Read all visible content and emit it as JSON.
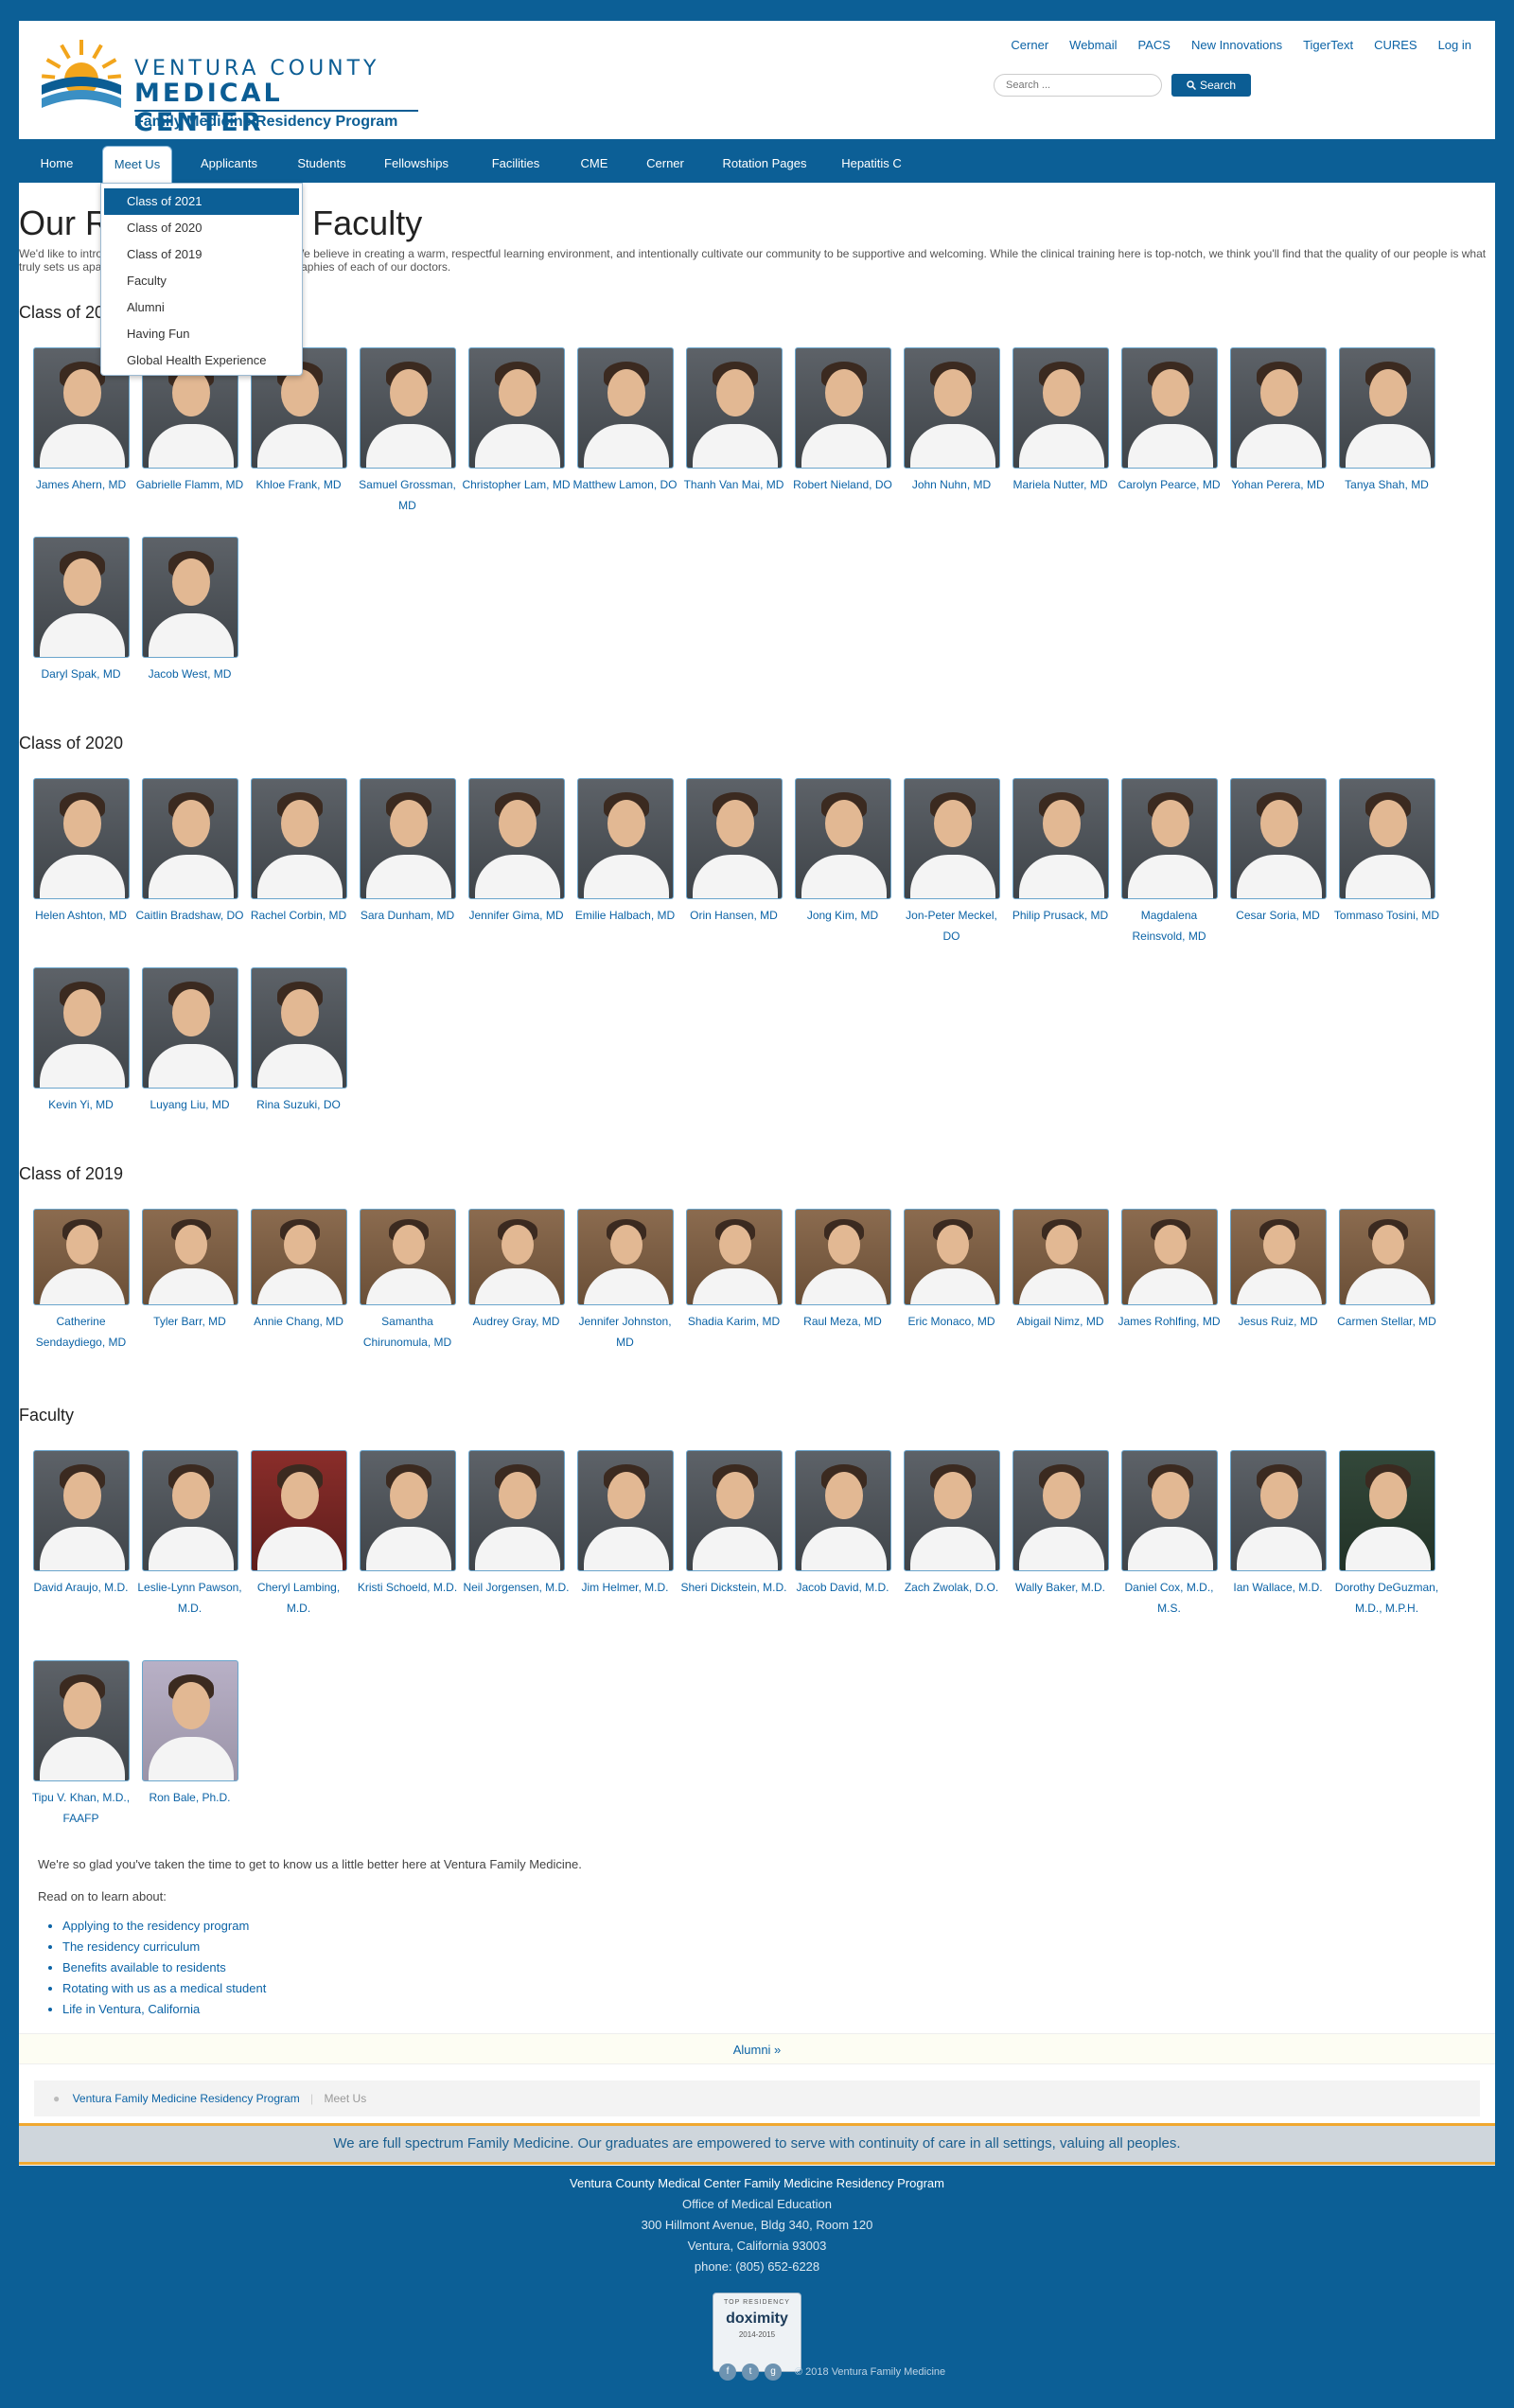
{
  "header": {
    "logo": {
      "line1": "VENTURA COUNTY",
      "line2": "MEDICAL CENTER",
      "line3": "Family Medicine Residency Program"
    },
    "top_links": [
      "Cerner",
      "Webmail",
      "PACS",
      "New Innovations",
      "TigerText",
      "CURES",
      "Log in"
    ],
    "search": {
      "placeholder": "Search ...",
      "button": "Search"
    }
  },
  "nav": {
    "items": [
      "Home",
      "Meet Us",
      "Applicants",
      "Students",
      "Fellowships",
      "Facilities",
      "CME",
      "Cerner",
      "Rotation Pages",
      "Hepatitis C"
    ],
    "active": "Meet Us",
    "dropdown": [
      "Class of 2021",
      "Class of 2020",
      "Class of 2019",
      "Faculty",
      "Alumni",
      "Having Fun",
      "Global Health Experience"
    ],
    "dropdown_selected": "Class of 2021"
  },
  "page": {
    "title": "Our Residents and Faculty",
    "intro": "We'd like to introduce you to our residents and faculty. We believe in creating a warm, respectful learning environment, and intentionally cultivate our community to be supportive and welcoming.  While the clinical training here is top-notch, we think you'll find that the quality of our people is what truly sets us apart. Click the images below for brief biographies of each of our doctors."
  },
  "sections": [
    {
      "title": "Class of 2021",
      "people": [
        "James Ahern, MD",
        "Gabrielle Flamm, MD",
        "Khloe Frank, MD",
        "Samuel Grossman, MD",
        "Christopher Lam, MD",
        "Matthew Lamon, DO",
        "Thanh Van Mai, MD",
        "Robert Nieland, DO",
        "John Nuhn, MD",
        "Mariela Nutter, MD",
        "Carolyn Pearce, MD",
        "Yohan Perera, MD",
        "Tanya Shah, MD",
        "Daryl Spak, MD",
        "Jacob West, MD"
      ]
    },
    {
      "title": "Class of 2020",
      "people": [
        "Helen Ashton, MD",
        "Caitlin Bradshaw, DO",
        "Rachel Corbin, MD",
        "Sara Dunham, MD",
        "Jennifer Gima, MD",
        "Emilie Halbach, MD",
        "Orin Hansen, MD",
        "Jong Kim, MD",
        "Jon-Peter Meckel, DO",
        "Philip Prusack, MD",
        "Magdalena Reinsvold, MD",
        "Cesar Soria, MD",
        "Tommaso Tosini, MD",
        "Kevin Yi, MD",
        "Luyang Liu, MD",
        "Rina Suzuki, DO"
      ]
    },
    {
      "title": "Class of 2019",
      "people": [
        "Catherine Sendaydiego, MD",
        "Tyler Barr, MD",
        "Annie Chang, MD",
        "Samantha Chirunomula, MD",
        "Audrey Gray, MD",
        "Jennifer Johnston, MD",
        "Shadia Karim, MD",
        "Raul Meza, MD",
        "Eric Monaco, MD",
        "Abigail Nimz, MD",
        "James Rohlfing, MD",
        "Jesus Ruiz, MD",
        "Carmen Stellar, MD"
      ]
    },
    {
      "title": "Faculty",
      "people": [
        "David Araujo, M.D.",
        "Leslie-Lynn Pawson, M.D.",
        "Cheryl Lambing, M.D.",
        "Kristi Schoeld, M.D.",
        "Neil Jorgensen, M.D.",
        "Jim Helmer, M.D.",
        "Sheri Dickstein, M.D.",
        "Jacob David, M.D.",
        "Zach Zwolak, D.O.",
        "Wally Baker, M.D.",
        "Daniel Cox, M.D., M.S.",
        "Ian Wallace, M.D.",
        "Dorothy DeGuzman, M.D., M.P.H.",
        "Tipu V. Khan, M.D., FAAFP",
        "Ron Bale, Ph.D."
      ]
    }
  ],
  "outro": {
    "p1": "We're so glad you've taken the time to get to know us a little better here at Ventura Family Medicine.",
    "p2": "Read on to learn about:",
    "links": [
      "Applying to the residency program",
      "The residency curriculum",
      "Benefits available to residents",
      "Rotating with us as a medical student",
      "Life in Ventura, California"
    ]
  },
  "pager": "Alumni »",
  "breadcrumb": [
    "Ventura Family Medicine Residency Program",
    "Meet Us"
  ],
  "mission": "We are full spectrum Family Medicine. Our graduates are empowered to serve with continuity of care in all settings, valuing all peoples.",
  "footer": {
    "org": "Ventura County Medical Center Family Medicine Residency Program",
    "office": "Office of Medical Education",
    "address1": "300 Hillmont Avenue, Bldg 340, Room 120",
    "address2": "Ventura, California 93003",
    "phone": "phone: (805) 652-6228",
    "badge": {
      "line1": "TOP RESIDENCY",
      "line2": "doximity",
      "line3": "2014-2015"
    },
    "copyright": "2018 Ventura Family Medicine"
  },
  "colors": {
    "brand": "#0c5f96",
    "link": "#0b63a6",
    "accent": "#f0a830"
  }
}
